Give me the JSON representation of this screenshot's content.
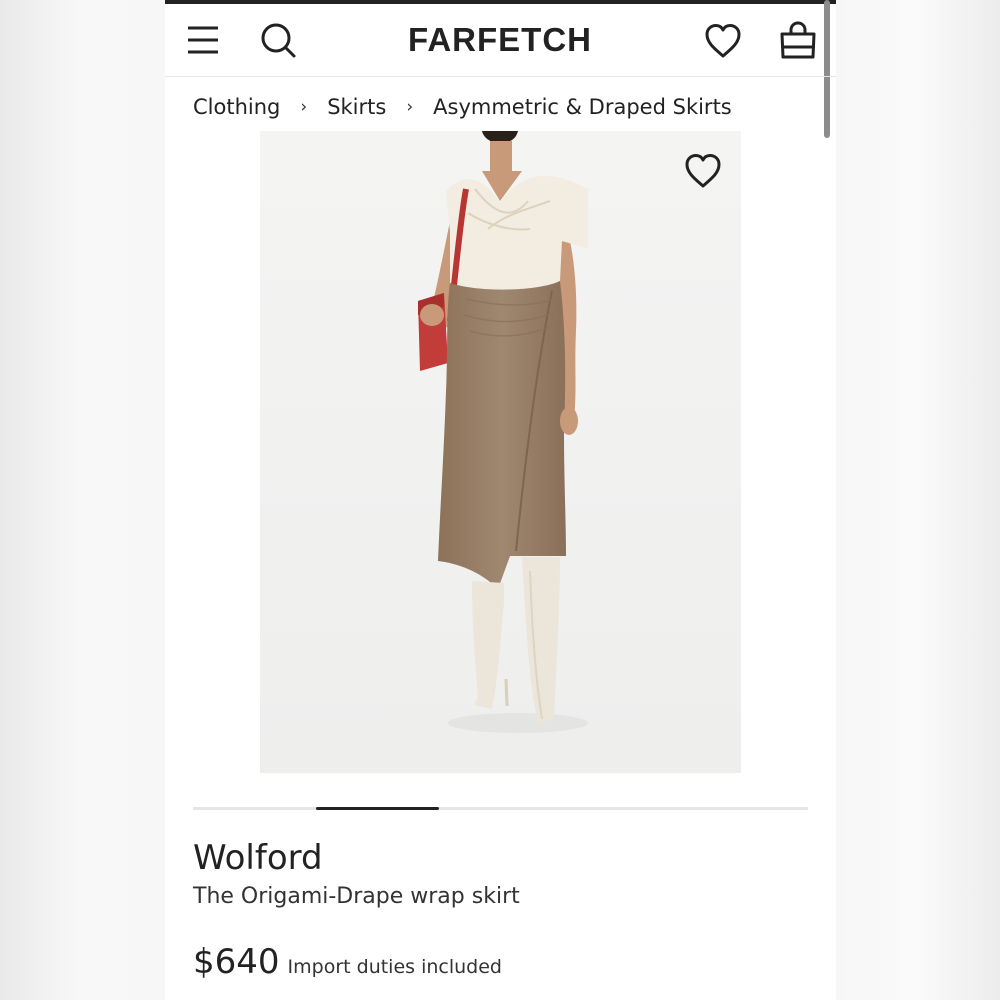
{
  "header": {
    "logo": "FARFETCH",
    "icons": {
      "menu": "hamburger-menu-icon",
      "search": "search-icon",
      "wishlist": "heart-icon",
      "bag": "shopping-bag-icon"
    }
  },
  "breadcrumb": {
    "items": [
      "Clothing",
      "Skirts",
      "Asymmetric & Draped Skirts"
    ],
    "separator": "›"
  },
  "gallery": {
    "wishlist_icon": "heart-outline-icon",
    "slide_progress": {
      "start_fraction": 0.2,
      "fill_fraction": 0.2
    },
    "colors": {
      "background": "#f3f3f2",
      "top": "#f3ece0",
      "skirt": "#9a8068",
      "bag": "#c23c3a",
      "boots": "#ece6da",
      "skin": "#c99a7a"
    }
  },
  "product": {
    "brand": "Wolford",
    "name": "The Origami-Drape wrap skirt",
    "price": "$640",
    "price_note": "Import duties included"
  },
  "colors": {
    "text": "#222222",
    "divider": "#e6e6e6",
    "progress_track": "#e5e5e5",
    "progress_fill": "#222222"
  }
}
